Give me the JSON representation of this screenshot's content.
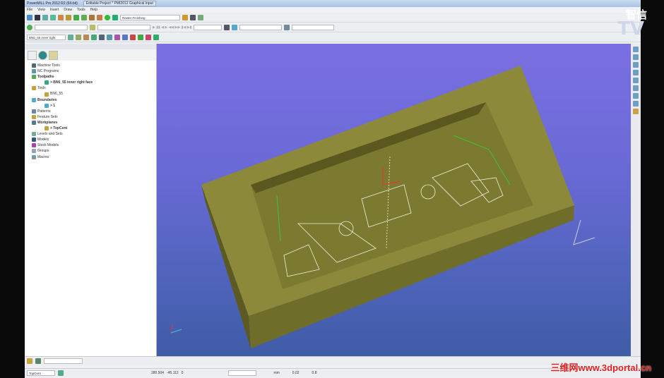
{
  "window": {
    "title": "PowerMILL Pro 2012 R2 (64-bit)",
    "project_tab": "Editable Project * PMI2012 Graphical Input"
  },
  "menu": [
    "File",
    "View",
    "Insert",
    "Draw",
    "Tools",
    "Help"
  ],
  "toolbar": {
    "strategy": "Raster Finishing",
    "toolpath_select": "BN6_55 inner right"
  },
  "tree": [
    {
      "label": "Machine Tools",
      "bold": false,
      "indent": 0
    },
    {
      "label": "NC Programs",
      "bold": false,
      "indent": 0
    },
    {
      "label": "Toolpaths",
      "bold": true,
      "indent": 0
    },
    {
      "label": "> BN6_55 inner right face",
      "bold": true,
      "indent": 1
    },
    {
      "label": "Tools",
      "bold": false,
      "indent": 0
    },
    {
      "label": "BN6_55",
      "bold": false,
      "indent": 1
    },
    {
      "label": "Boundaries",
      "bold": true,
      "indent": 0
    },
    {
      "label": "> 1",
      "bold": true,
      "indent": 1
    },
    {
      "label": "Patterns",
      "bold": false,
      "indent": 0
    },
    {
      "label": "Feature Sets",
      "bold": false,
      "indent": 0
    },
    {
      "label": "Workplanes",
      "bold": true,
      "indent": 0
    },
    {
      "label": "> TopCent",
      "bold": true,
      "indent": 1
    },
    {
      "label": "Levels and Sets",
      "bold": false,
      "indent": 0
    },
    {
      "label": "Models",
      "bold": false,
      "indent": 0
    },
    {
      "label": "Stock Models",
      "bold": false,
      "indent": 0
    },
    {
      "label": "Groups",
      "bold": false,
      "indent": 0
    },
    {
      "label": "Macros",
      "bold": false,
      "indent": 0
    }
  ],
  "status": {
    "workplane": "TopCent",
    "x": "280.504",
    "y": "-45.112",
    "z": "0",
    "units": "mm",
    "tolerance": "0.02",
    "stepover": "0.8"
  },
  "watermarks": {
    "brand_cn": "智信",
    "brand_tv": "TV",
    "site": "三维网www.3dportal.cn"
  },
  "colors": {
    "model": "#8c8a3a",
    "viewport_top": "#7a6fe2",
    "viewport_bottom": "#3f5ca6"
  }
}
